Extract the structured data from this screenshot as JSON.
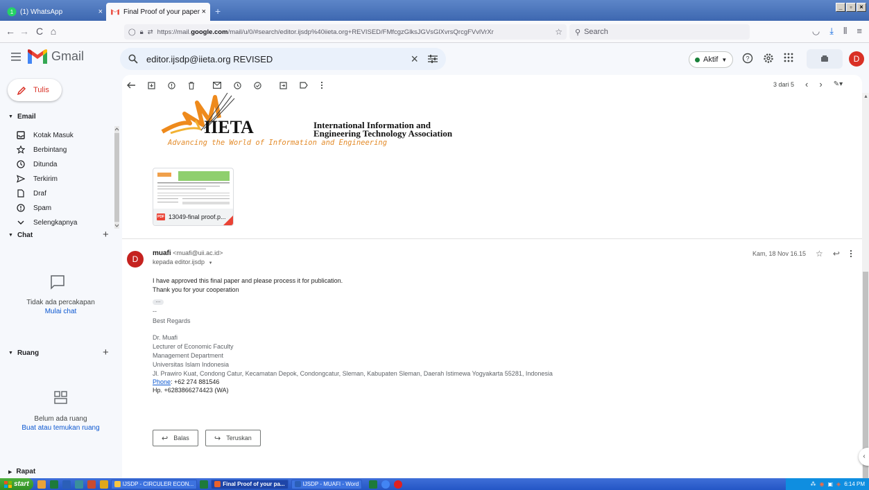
{
  "browser": {
    "tabs": [
      {
        "label": "(1) WhatsApp",
        "close": "×"
      },
      {
        "label": "Final Proof of your paper submitte",
        "close": "×"
      }
    ],
    "new_tab": "+",
    "url_prefix": "https://mail.",
    "url_domain": "google.com",
    "url_rest": "/mail/u/0/#search/editor.ijsdp%40iieta.org+REVISED/FMfcgzGlksJGVsGlXvrsQrcgFVvlVrXr",
    "search_placeholder": "Search"
  },
  "gmail": {
    "logo_text": "Gmail",
    "search_value": "editor.ijsdp@iieta.org REVISED",
    "status_label": "Aktif",
    "avatar_letter": "D"
  },
  "sidebar": {
    "compose_label": "Tulis",
    "email_section": "Email",
    "items": [
      {
        "label": "Kotak Masuk",
        "icon": "inbox-icon"
      },
      {
        "label": "Berbintang",
        "icon": "star-icon"
      },
      {
        "label": "Ditunda",
        "icon": "clock-icon"
      },
      {
        "label": "Terkirim",
        "icon": "send-icon"
      },
      {
        "label": "Draf",
        "icon": "draft-icon"
      },
      {
        "label": "Spam",
        "icon": "spam-icon"
      },
      {
        "label": "Selengkapnya",
        "icon": "chevron-down-icon"
      }
    ],
    "chat_section": "Chat",
    "chat_empty": "Tidak ada percakapan",
    "chat_link": "Mulai chat",
    "rooms_section": "Ruang",
    "rooms_empty": "Belum ada ruang",
    "rooms_link": "Buat atau temukan ruang",
    "meet_section": "Rapat"
  },
  "toolbar": {
    "pager_text": "3 dari 5"
  },
  "email": {
    "ieta_name_line1": "International Information and",
    "ieta_name_line2": "Engineering Technology Association",
    "ieta_tagline": "Advancing the World of Information and Engineering",
    "attachment_name": "13049-final proof.p...",
    "sender_name": "muafi",
    "sender_email": "<muafi@uii.ac.id>",
    "recipient": "kepada editor.ijsdp",
    "date": "Kam, 18 Nov 16.15",
    "body_line1": "I have approved this final paper and please process it for publication.",
    "body_line2": "Thank you for your cooperation",
    "sig_dash": "--",
    "sig_regards": "Best Regards",
    "sig_name": "Dr. Muafi",
    "sig_title": "Lecturer of Economic Faculty",
    "sig_dept": "Management Department",
    "sig_univ": "Universitas Islam Indonesia",
    "sig_address": "Jl. Prawiro Kuat, Condong Catur, Kecamatan Depok, Condongcatur, Sleman, Kabupaten Sleman, Daerah Istimewa Yogyakarta 55281, Indonesia",
    "sig_phone_label": "Phone",
    "sig_phone": ": +62 274 881546",
    "sig_hp": "Hp. +6283866274423 (WA)",
    "reply_label": "Balas",
    "forward_label": "Teruskan"
  },
  "taskbar": {
    "start_label": "start",
    "tasks": [
      {
        "label": "IJSDP - CIRCULER ECON...",
        "color": "#f5c542"
      },
      {
        "label": "Final Proof of your pa...",
        "color": "#e8622b"
      },
      {
        "label": "IJSDP - MUAFI - Word",
        "color": "#2b5fb8"
      }
    ],
    "clock": "6:14 PM"
  },
  "colors": {
    "gmail_red": "#ea4335",
    "accent_blue": "#0b57d0",
    "status_green": "#188038"
  }
}
